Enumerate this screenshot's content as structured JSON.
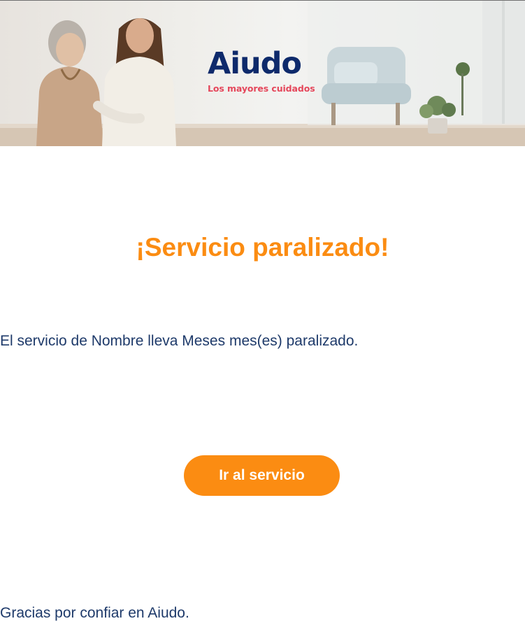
{
  "header": {
    "banner_image": "elderly-woman-with-young-caregiver-photo",
    "logo": {
      "wordmark": "Aiudo",
      "tagline": "Los mayores cuidados",
      "wordmark_color": "#0e2a6b",
      "accent_color": "#e5475b"
    }
  },
  "main": {
    "title": "¡Servicio paralizado!",
    "message": "El servicio de Nombre lleva Meses mes(es) paralizado.",
    "cta_label": "Ir al servicio",
    "closing": "Gracias por confiar en Aiudo."
  },
  "colors": {
    "accent": "#fb8c12",
    "text": "#1e3a6a",
    "background": "#ffffff"
  }
}
